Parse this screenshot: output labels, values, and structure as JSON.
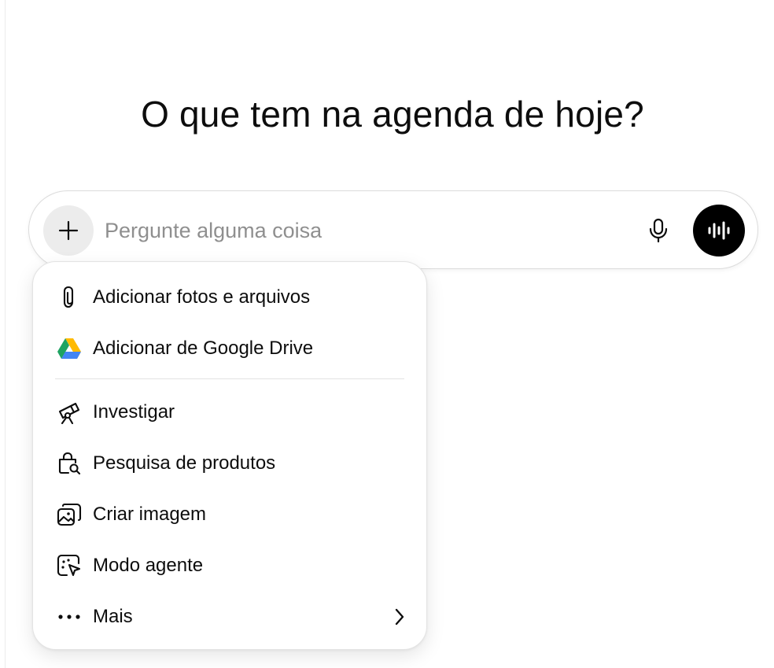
{
  "headline": "O que tem na agenda de hoje?",
  "composer": {
    "placeholder": "Pergunte alguma coisa",
    "value": "",
    "plus_icon": "plus-icon",
    "mic_icon": "microphone-icon",
    "voice_icon": "voice-waveform-icon"
  },
  "menu": {
    "items": [
      {
        "label": "Adicionar fotos e arquivos",
        "icon": "paperclip-icon"
      },
      {
        "label": "Adicionar de Google Drive",
        "icon": "google-drive-icon"
      },
      {
        "label": "Investigar",
        "icon": "telescope-icon"
      },
      {
        "label": "Pesquisa de produtos",
        "icon": "shopping-bag-search-icon"
      },
      {
        "label": "Criar imagem",
        "icon": "image-gallery-icon"
      },
      {
        "label": "Modo agente",
        "icon": "agent-cursor-icon"
      },
      {
        "label": "Mais",
        "icon": "more-dots-icon",
        "trailing_icon": "chevron-right-icon"
      }
    ]
  },
  "colors": {
    "background": "#ffffff",
    "text": "#0d0d0d",
    "placeholder": "#8f8f8f",
    "plus_button_bg": "#ececec",
    "voice_button_bg": "#000000",
    "border": "#dcdcdc",
    "drive_green": "#1ea362",
    "drive_yellow": "#ffba00",
    "drive_blue": "#4285f4"
  }
}
